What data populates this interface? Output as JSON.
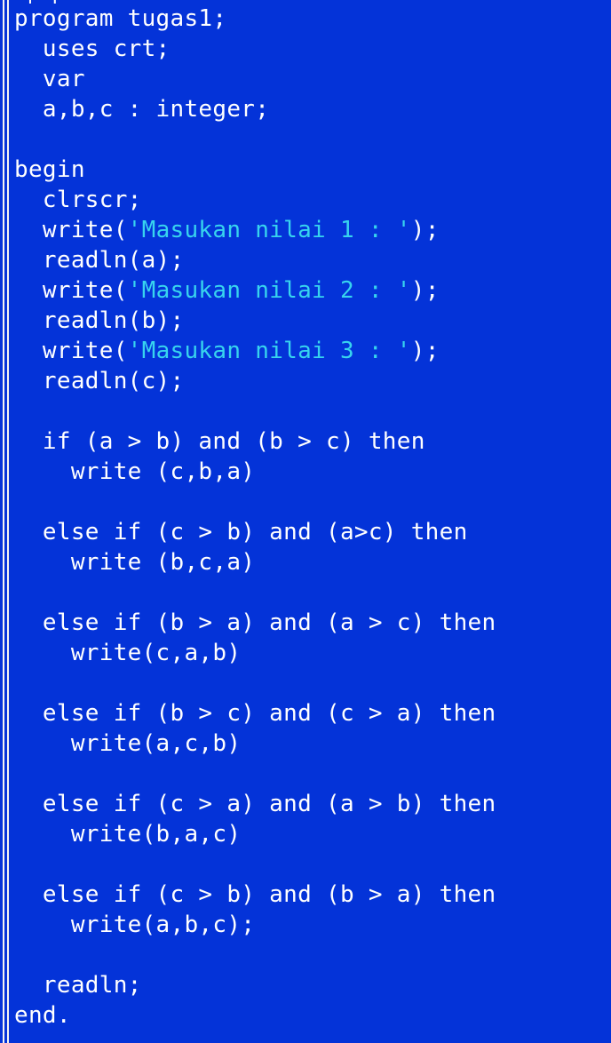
{
  "editor": {
    "theme": {
      "background": "#0433d8",
      "text": "#ffffff",
      "string": "#37d4ee",
      "frame": "#f2f2f2"
    },
    "top_glyph": "[ ]",
    "lines": [
      {
        "indent": 0,
        "parts": [
          {
            "t": "program tugas1;"
          }
        ]
      },
      {
        "indent": 2,
        "parts": [
          {
            "t": "uses crt;"
          }
        ]
      },
      {
        "indent": 2,
        "parts": [
          {
            "t": "var"
          }
        ]
      },
      {
        "indent": 2,
        "parts": [
          {
            "t": "a,b,c : integer;"
          }
        ]
      },
      {
        "indent": 0,
        "parts": []
      },
      {
        "indent": 0,
        "parts": [
          {
            "t": "begin"
          }
        ]
      },
      {
        "indent": 2,
        "parts": [
          {
            "t": "clrscr;"
          }
        ]
      },
      {
        "indent": 2,
        "parts": [
          {
            "t": "write("
          },
          {
            "t": "'Masukan nilai 1 : '",
            "s": true
          },
          {
            "t": ");"
          }
        ]
      },
      {
        "indent": 2,
        "parts": [
          {
            "t": "readln(a);"
          }
        ]
      },
      {
        "indent": 2,
        "parts": [
          {
            "t": "write("
          },
          {
            "t": "'Masukan nilai 2 : '",
            "s": true
          },
          {
            "t": ");"
          }
        ]
      },
      {
        "indent": 2,
        "parts": [
          {
            "t": "readln(b);"
          }
        ]
      },
      {
        "indent": 2,
        "parts": [
          {
            "t": "write("
          },
          {
            "t": "'Masukan nilai 3 : '",
            "s": true
          },
          {
            "t": ");"
          }
        ]
      },
      {
        "indent": 2,
        "parts": [
          {
            "t": "readln(c);"
          }
        ]
      },
      {
        "indent": 0,
        "parts": []
      },
      {
        "indent": 2,
        "parts": [
          {
            "t": "if (a > b) and (b > c) then"
          }
        ]
      },
      {
        "indent": 4,
        "parts": [
          {
            "t": "write (c,b,a)"
          }
        ]
      },
      {
        "indent": 0,
        "parts": []
      },
      {
        "indent": 2,
        "parts": [
          {
            "t": "else if (c > b) and (a>c) then"
          }
        ]
      },
      {
        "indent": 4,
        "parts": [
          {
            "t": "write (b,c,a)"
          }
        ]
      },
      {
        "indent": 0,
        "parts": []
      },
      {
        "indent": 2,
        "parts": [
          {
            "t": "else if (b > a) and (a > c) then"
          }
        ]
      },
      {
        "indent": 4,
        "parts": [
          {
            "t": "write(c,a,b)"
          }
        ]
      },
      {
        "indent": 0,
        "parts": []
      },
      {
        "indent": 2,
        "parts": [
          {
            "t": "else if (b > c) and (c > a) then"
          }
        ]
      },
      {
        "indent": 4,
        "parts": [
          {
            "t": "write(a,c,b)"
          }
        ]
      },
      {
        "indent": 0,
        "parts": []
      },
      {
        "indent": 2,
        "parts": [
          {
            "t": "else if (c > a) and (a > b) then"
          }
        ]
      },
      {
        "indent": 4,
        "parts": [
          {
            "t": "write(b,a,c)"
          }
        ]
      },
      {
        "indent": 0,
        "parts": []
      },
      {
        "indent": 2,
        "parts": [
          {
            "t": "else if (c > b) and (b > a) then"
          }
        ]
      },
      {
        "indent": 4,
        "parts": [
          {
            "t": "write(a,b,c);"
          }
        ]
      },
      {
        "indent": 0,
        "parts": []
      },
      {
        "indent": 2,
        "parts": [
          {
            "t": "readln;"
          }
        ]
      },
      {
        "indent": 0,
        "parts": [
          {
            "t": "end."
          }
        ]
      }
    ]
  }
}
